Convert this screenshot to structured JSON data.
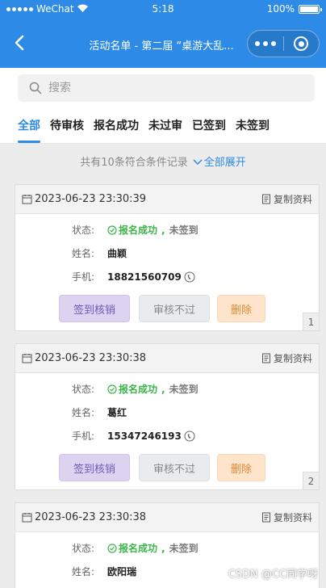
{
  "status_bar": {
    "carrier": "WeChat",
    "time": "5:18",
    "battery": "100%"
  },
  "navbar": {
    "title": "活动名单 - 第二届 “桌游大乱..."
  },
  "search": {
    "placeholder": "搜索"
  },
  "tabs": [
    {
      "label": "全部",
      "active": true
    },
    {
      "label": "待审核"
    },
    {
      "label": "报名成功"
    },
    {
      "label": "未过审"
    },
    {
      "label": "已签到"
    },
    {
      "label": "未签到"
    }
  ],
  "summary": {
    "text": "共有10条符合条件记录",
    "expand": "全部展开"
  },
  "labels": {
    "status": "状态:",
    "name": "姓名:",
    "phone": "手机:",
    "copy": "复制资料"
  },
  "buttons": {
    "checkin": "签到核销",
    "reject": "审核不过",
    "delete": "删除"
  },
  "records": [
    {
      "datetime": "2023-06-23 23:30:39",
      "status_ok": "报名成功",
      "status_sign": "未签到",
      "name": "曲颖",
      "phone": "18821560709",
      "index": "1"
    },
    {
      "datetime": "2023-06-23 23:30:38",
      "status_ok": "报名成功",
      "status_sign": "未签到",
      "name": "葛红",
      "phone": "15347246193",
      "index": "2"
    },
    {
      "datetime": "2023-06-23 23:30:38",
      "status_ok": "报名成功",
      "status_sign": "未签到",
      "name": "欧阳瑞"
    }
  ],
  "watermark": "CSDN @CC同学呀",
  "colors": {
    "primary": "#2d8ae6",
    "success": "#3bb54a"
  }
}
